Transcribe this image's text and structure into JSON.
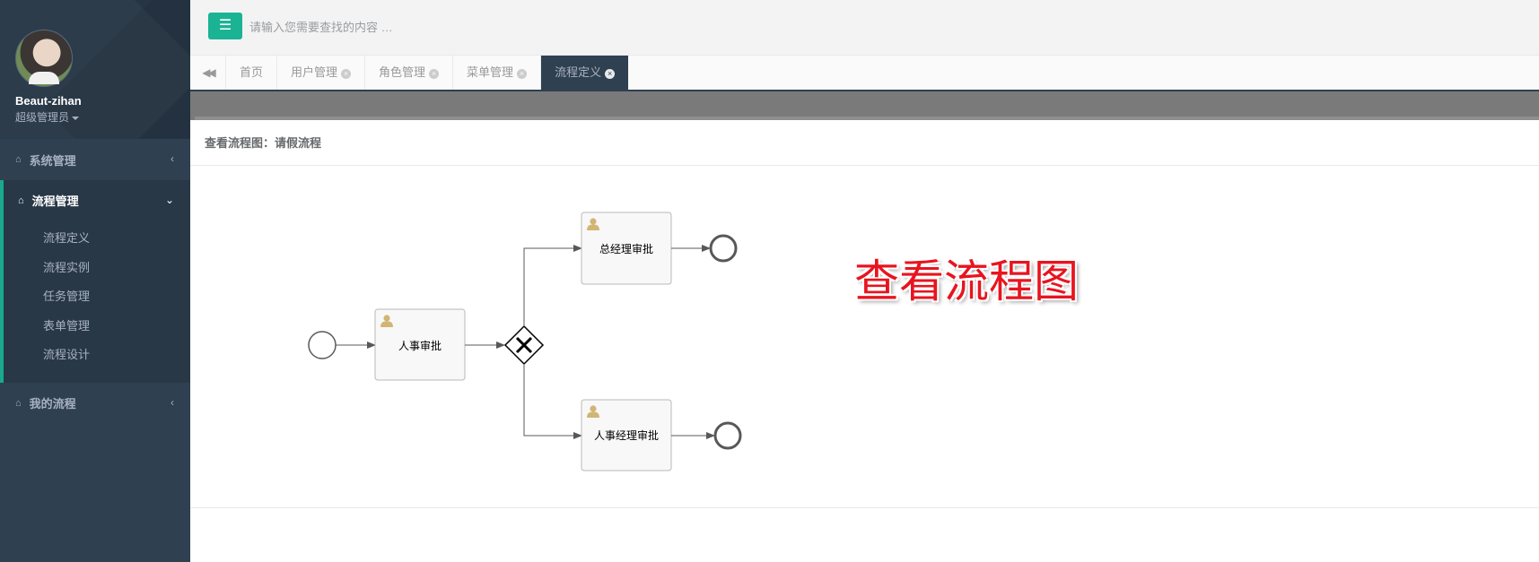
{
  "user": {
    "name": "Beaut-zihan",
    "role": "超级管理员"
  },
  "sidebar": {
    "items": [
      {
        "label": "系统管理",
        "icon": "home-icon",
        "expanded": false
      },
      {
        "label": "流程管理",
        "icon": "home-icon",
        "expanded": true,
        "children": [
          "流程定义",
          "流程实例",
          "任务管理",
          "表单管理",
          "流程设计"
        ]
      },
      {
        "label": "我的流程",
        "icon": "home-icon",
        "expanded": false
      }
    ]
  },
  "topbar": {
    "menu_icon": "hamburger-icon",
    "search_placeholder": "请输入您需要查找的内容 …"
  },
  "tabs": {
    "back_icon": "double-chevron-left-icon",
    "items": [
      {
        "label": "首页",
        "closable": false,
        "active": false
      },
      {
        "label": "用户管理",
        "closable": true,
        "active": false
      },
      {
        "label": "角色管理",
        "closable": true,
        "active": false
      },
      {
        "label": "菜单管理",
        "closable": true,
        "active": false
      },
      {
        "label": "流程定义",
        "closable": true,
        "active": true
      }
    ]
  },
  "panel": {
    "title": "查看流程图：请假流程"
  },
  "diagram": {
    "tasks": {
      "hr_review": "人事审批",
      "gm_review": "总经理审批",
      "hr_manager_review": "人事经理审批"
    },
    "overlay_text": "查看流程图"
  },
  "colors": {
    "accent": "#1ab394",
    "sidebar": "#2f4050",
    "overlay_text": "#e8141f"
  }
}
